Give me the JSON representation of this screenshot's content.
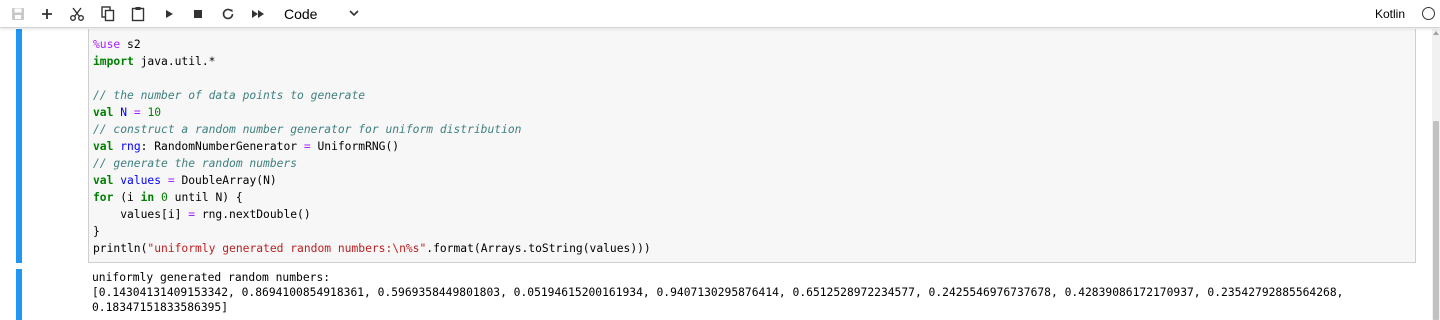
{
  "toolbar": {
    "buttons": [
      {
        "name": "save-icon"
      },
      {
        "name": "insert-cell-icon"
      },
      {
        "name": "cut-icon"
      },
      {
        "name": "copy-icon"
      },
      {
        "name": "paste-icon"
      },
      {
        "name": "run-icon"
      },
      {
        "name": "interrupt-icon"
      },
      {
        "name": "restart-icon"
      },
      {
        "name": "fast-forward-icon"
      }
    ],
    "cell_type": "Code",
    "kernel_name": "Kotlin",
    "kernel_status": "idle"
  },
  "cell": {
    "code_lines": [
      [
        {
          "t": "%use",
          "c": "magic"
        },
        {
          "t": " s2",
          "c": ""
        }
      ],
      [
        {
          "t": "import",
          "c": "kw"
        },
        {
          "t": " java.util.*",
          "c": ""
        }
      ],
      [],
      [
        {
          "t": "// the number of data points to generate",
          "c": "cmt"
        }
      ],
      [
        {
          "t": "val",
          "c": "kw"
        },
        {
          "t": " ",
          "c": ""
        },
        {
          "t": "N",
          "c": "var"
        },
        {
          "t": " ",
          "c": ""
        },
        {
          "t": "=",
          "c": "op"
        },
        {
          "t": " ",
          "c": ""
        },
        {
          "t": "10",
          "c": "num"
        }
      ],
      [
        {
          "t": "// construct a random number generator for uniform distribution",
          "c": "cmt"
        }
      ],
      [
        {
          "t": "val",
          "c": "kw"
        },
        {
          "t": " ",
          "c": ""
        },
        {
          "t": "rng",
          "c": "var"
        },
        {
          "t": ": RandomNumberGenerator ",
          "c": ""
        },
        {
          "t": "=",
          "c": "op"
        },
        {
          "t": " UniformRNG()",
          "c": ""
        }
      ],
      [
        {
          "t": "// generate the random numbers",
          "c": "cmt"
        }
      ],
      [
        {
          "t": "val",
          "c": "kw"
        },
        {
          "t": " ",
          "c": ""
        },
        {
          "t": "values",
          "c": "var"
        },
        {
          "t": " ",
          "c": ""
        },
        {
          "t": "=",
          "c": "op"
        },
        {
          "t": " DoubleArray(N)",
          "c": ""
        }
      ],
      [
        {
          "t": "for",
          "c": "kw"
        },
        {
          "t": " (i ",
          "c": ""
        },
        {
          "t": "in",
          "c": "kw"
        },
        {
          "t": " ",
          "c": ""
        },
        {
          "t": "0",
          "c": "num"
        },
        {
          "t": " until N) {",
          "c": ""
        }
      ],
      [
        {
          "t": "    values[i] ",
          "c": ""
        },
        {
          "t": "=",
          "c": "op"
        },
        {
          "t": " rng.nextDouble()",
          "c": ""
        }
      ],
      [
        {
          "t": "}",
          "c": ""
        }
      ],
      [
        {
          "t": "println(",
          "c": ""
        },
        {
          "t": "\"uniformly generated random numbers:\\n%s\"",
          "c": "str"
        },
        {
          "t": ".format(Arrays.toString(values)))",
          "c": ""
        }
      ]
    ],
    "output": "uniformly generated random numbers:\n[0.14304131409153342, 0.8694100854918361, 0.5969358449801803, 0.05194615200161934, 0.9407130295876414, 0.6512528972234577, 0.2425546976737678, 0.42839086172170937, 0.23542792885564268,\n0.18347151833586395]"
  }
}
